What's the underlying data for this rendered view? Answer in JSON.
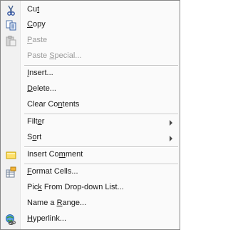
{
  "menu": {
    "items": [
      {
        "id": "cut",
        "pre": "Cu",
        "key": "t",
        "post": "",
        "disabled": false,
        "icon": "scissors-icon"
      },
      {
        "id": "copy",
        "pre": "",
        "key": "C",
        "post": "opy",
        "disabled": false,
        "icon": "copy-icon"
      },
      {
        "id": "paste",
        "pre": "",
        "key": "P",
        "post": "aste",
        "disabled": true,
        "icon": "paste-icon"
      },
      {
        "id": "paste-special",
        "pre": "Paste ",
        "key": "S",
        "post": "pecial...",
        "disabled": true,
        "icon": ""
      },
      {
        "id": "insert",
        "pre": "",
        "key": "I",
        "post": "nsert...",
        "disabled": false,
        "icon": ""
      },
      {
        "id": "delete",
        "pre": "",
        "key": "D",
        "post": "elete...",
        "disabled": false,
        "icon": ""
      },
      {
        "id": "clear-contents",
        "pre": "Clear Co",
        "key": "n",
        "post": "tents",
        "disabled": false,
        "icon": ""
      },
      {
        "id": "filter",
        "pre": "Filt",
        "key": "e",
        "post": "r",
        "disabled": false,
        "icon": "",
        "submenu": true
      },
      {
        "id": "sort",
        "pre": "S",
        "key": "o",
        "post": "rt",
        "disabled": false,
        "icon": "",
        "submenu": true
      },
      {
        "id": "insert-comment",
        "pre": "Insert Co",
        "key": "m",
        "post": "ment",
        "disabled": false,
        "icon": "comment-icon"
      },
      {
        "id": "format-cells",
        "pre": "",
        "key": "F",
        "post": "ormat Cells...",
        "disabled": false,
        "icon": "format-cells-icon"
      },
      {
        "id": "pick-from-list",
        "pre": "Pic",
        "key": "k",
        "post": " From Drop-down List...",
        "disabled": false,
        "icon": ""
      },
      {
        "id": "name-range",
        "pre": "Name a ",
        "key": "R",
        "post": "ange...",
        "disabled": false,
        "icon": ""
      },
      {
        "id": "hyperlink",
        "pre": "",
        "key": "H",
        "post": "yperlink...",
        "disabled": false,
        "icon": "hyperlink-icon"
      }
    ]
  }
}
